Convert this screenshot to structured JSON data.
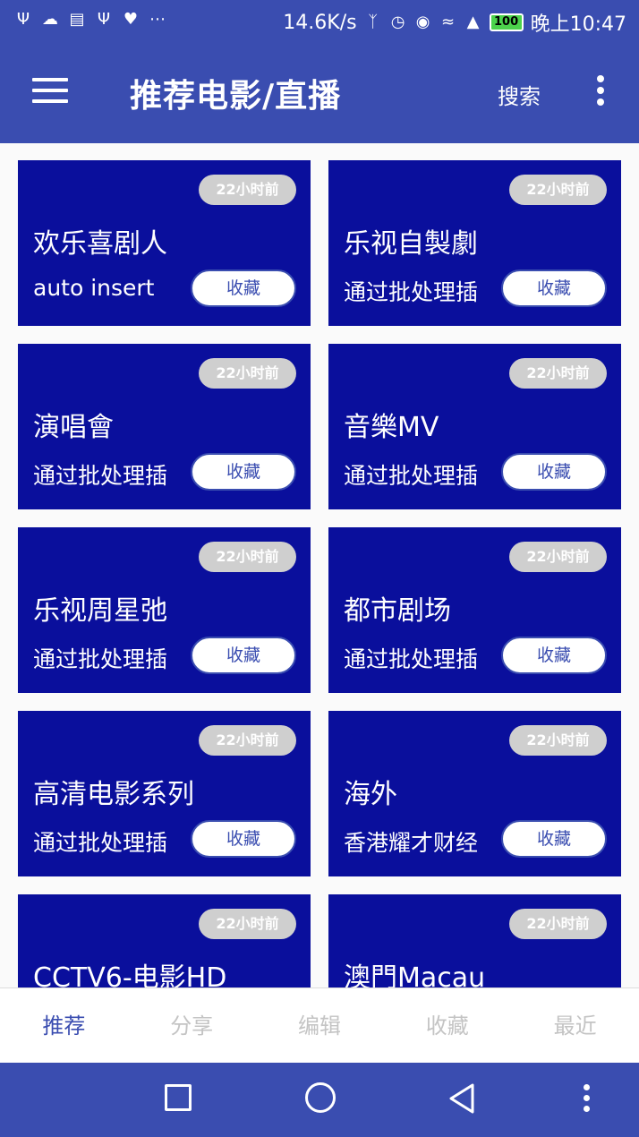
{
  "status_bar": {
    "speed": "14.6K/s",
    "battery": "100",
    "time": "晚上10:47"
  },
  "app_bar": {
    "title": "推荐电影/直播",
    "search": "搜索"
  },
  "cards": [
    {
      "badge": "22小时前",
      "title": "欢乐喜剧人",
      "subtitle": "auto insert",
      "fav": "收藏"
    },
    {
      "badge": "22小时前",
      "title": "乐视自製劇",
      "subtitle": "通过批处理插",
      "fav": "收藏"
    },
    {
      "badge": "22小时前",
      "title": "演唱會",
      "subtitle": "通过批处理插",
      "fav": "收藏"
    },
    {
      "badge": "22小时前",
      "title": "音樂MV",
      "subtitle": "通过批处理插",
      "fav": "收藏"
    },
    {
      "badge": "22小时前",
      "title": "乐视周星弛",
      "subtitle": "通过批处理插",
      "fav": "收藏"
    },
    {
      "badge": "22小时前",
      "title": "都市剧场",
      "subtitle": "通过批处理插",
      "fav": "收藏"
    },
    {
      "badge": "22小时前",
      "title": "高清电影系列",
      "subtitle": "通过批处理插",
      "fav": "收藏"
    },
    {
      "badge": "22小时前",
      "title": "海外",
      "subtitle": "香港耀才财经",
      "fav": "收藏"
    },
    {
      "badge": "22小时前",
      "title": "CCTV6-电影HD",
      "subtitle": "",
      "fav": ""
    },
    {
      "badge": "22小时前",
      "title": "澳門Macau",
      "subtitle": "",
      "fav": ""
    }
  ],
  "tabs": [
    {
      "label": "推荐",
      "active": true
    },
    {
      "label": "分享",
      "active": false
    },
    {
      "label": "编辑",
      "active": false
    },
    {
      "label": "收藏",
      "active": false
    },
    {
      "label": "最近",
      "active": false
    }
  ],
  "colors": {
    "primary": "#3a4db0",
    "card": "#0a0f9c",
    "badge": "#cfcfcf"
  }
}
